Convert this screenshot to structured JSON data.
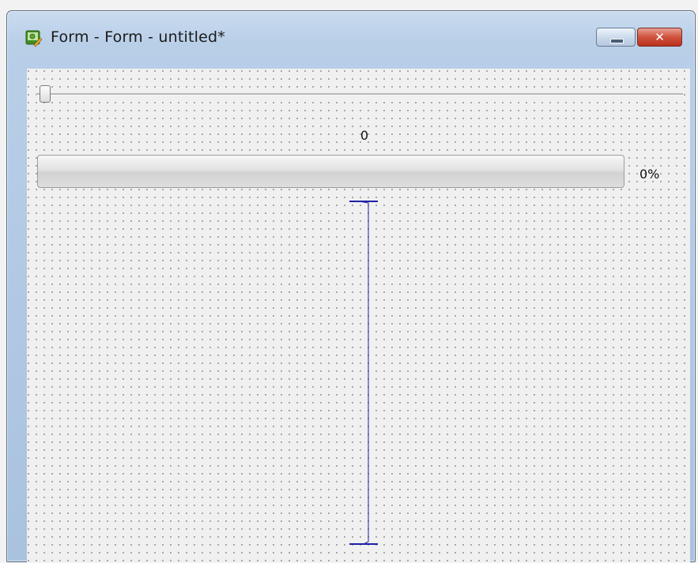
{
  "window": {
    "title": "Form - Form - untitled*",
    "close_glyph": "✕"
  },
  "form": {
    "slider": {
      "value": 0,
      "min": 0,
      "max": 99
    },
    "value_label": "0",
    "progress": {
      "value": 0,
      "text": "0%"
    },
    "spacer": {
      "orientation": "vertical",
      "color": "#1f1fa8"
    }
  },
  "colors": {
    "title_bar": "#b9cfe8",
    "close_button": "#d0523e",
    "spacer": "#1f1fa8",
    "form_background": "#f0f0f0"
  },
  "icons": [
    "designer-app-icon",
    "minimize-icon",
    "close-icon"
  ]
}
